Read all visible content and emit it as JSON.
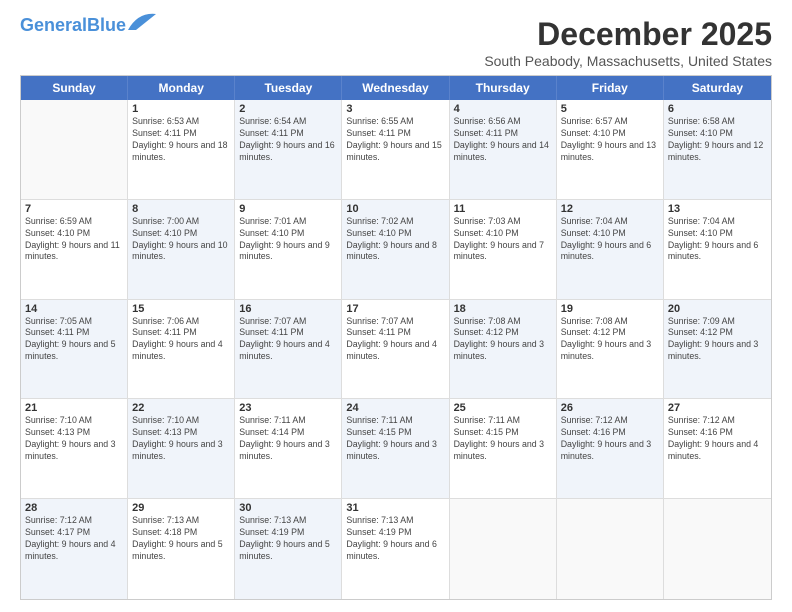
{
  "logo": {
    "part1": "General",
    "part2": "Blue"
  },
  "title": "December 2025",
  "subtitle": "South Peabody, Massachusetts, United States",
  "header_days": [
    "Sunday",
    "Monday",
    "Tuesday",
    "Wednesday",
    "Thursday",
    "Friday",
    "Saturday"
  ],
  "weeks": [
    [
      {
        "day": "",
        "sunrise": "",
        "sunset": "",
        "daylight": "",
        "shaded": false,
        "empty": true
      },
      {
        "day": "1",
        "sunrise": "Sunrise: 6:53 AM",
        "sunset": "Sunset: 4:11 PM",
        "daylight": "Daylight: 9 hours and 18 minutes.",
        "shaded": false,
        "empty": false
      },
      {
        "day": "2",
        "sunrise": "Sunrise: 6:54 AM",
        "sunset": "Sunset: 4:11 PM",
        "daylight": "Daylight: 9 hours and 16 minutes.",
        "shaded": true,
        "empty": false
      },
      {
        "day": "3",
        "sunrise": "Sunrise: 6:55 AM",
        "sunset": "Sunset: 4:11 PM",
        "daylight": "Daylight: 9 hours and 15 minutes.",
        "shaded": false,
        "empty": false
      },
      {
        "day": "4",
        "sunrise": "Sunrise: 6:56 AM",
        "sunset": "Sunset: 4:11 PM",
        "daylight": "Daylight: 9 hours and 14 minutes.",
        "shaded": true,
        "empty": false
      },
      {
        "day": "5",
        "sunrise": "Sunrise: 6:57 AM",
        "sunset": "Sunset: 4:10 PM",
        "daylight": "Daylight: 9 hours and 13 minutes.",
        "shaded": false,
        "empty": false
      },
      {
        "day": "6",
        "sunrise": "Sunrise: 6:58 AM",
        "sunset": "Sunset: 4:10 PM",
        "daylight": "Daylight: 9 hours and 12 minutes.",
        "shaded": true,
        "empty": false
      }
    ],
    [
      {
        "day": "7",
        "sunrise": "Sunrise: 6:59 AM",
        "sunset": "Sunset: 4:10 PM",
        "daylight": "Daylight: 9 hours and 11 minutes.",
        "shaded": false,
        "empty": false
      },
      {
        "day": "8",
        "sunrise": "Sunrise: 7:00 AM",
        "sunset": "Sunset: 4:10 PM",
        "daylight": "Daylight: 9 hours and 10 minutes.",
        "shaded": true,
        "empty": false
      },
      {
        "day": "9",
        "sunrise": "Sunrise: 7:01 AM",
        "sunset": "Sunset: 4:10 PM",
        "daylight": "Daylight: 9 hours and 9 minutes.",
        "shaded": false,
        "empty": false
      },
      {
        "day": "10",
        "sunrise": "Sunrise: 7:02 AM",
        "sunset": "Sunset: 4:10 PM",
        "daylight": "Daylight: 9 hours and 8 minutes.",
        "shaded": true,
        "empty": false
      },
      {
        "day": "11",
        "sunrise": "Sunrise: 7:03 AM",
        "sunset": "Sunset: 4:10 PM",
        "daylight": "Daylight: 9 hours and 7 minutes.",
        "shaded": false,
        "empty": false
      },
      {
        "day": "12",
        "sunrise": "Sunrise: 7:04 AM",
        "sunset": "Sunset: 4:10 PM",
        "daylight": "Daylight: 9 hours and 6 minutes.",
        "shaded": true,
        "empty": false
      },
      {
        "day": "13",
        "sunrise": "Sunrise: 7:04 AM",
        "sunset": "Sunset: 4:10 PM",
        "daylight": "Daylight: 9 hours and 6 minutes.",
        "shaded": false,
        "empty": false
      }
    ],
    [
      {
        "day": "14",
        "sunrise": "Sunrise: 7:05 AM",
        "sunset": "Sunset: 4:11 PM",
        "daylight": "Daylight: 9 hours and 5 minutes.",
        "shaded": true,
        "empty": false
      },
      {
        "day": "15",
        "sunrise": "Sunrise: 7:06 AM",
        "sunset": "Sunset: 4:11 PM",
        "daylight": "Daylight: 9 hours and 4 minutes.",
        "shaded": false,
        "empty": false
      },
      {
        "day": "16",
        "sunrise": "Sunrise: 7:07 AM",
        "sunset": "Sunset: 4:11 PM",
        "daylight": "Daylight: 9 hours and 4 minutes.",
        "shaded": true,
        "empty": false
      },
      {
        "day": "17",
        "sunrise": "Sunrise: 7:07 AM",
        "sunset": "Sunset: 4:11 PM",
        "daylight": "Daylight: 9 hours and 4 minutes.",
        "shaded": false,
        "empty": false
      },
      {
        "day": "18",
        "sunrise": "Sunrise: 7:08 AM",
        "sunset": "Sunset: 4:12 PM",
        "daylight": "Daylight: 9 hours and 3 minutes.",
        "shaded": true,
        "empty": false
      },
      {
        "day": "19",
        "sunrise": "Sunrise: 7:08 AM",
        "sunset": "Sunset: 4:12 PM",
        "daylight": "Daylight: 9 hours and 3 minutes.",
        "shaded": false,
        "empty": false
      },
      {
        "day": "20",
        "sunrise": "Sunrise: 7:09 AM",
        "sunset": "Sunset: 4:12 PM",
        "daylight": "Daylight: 9 hours and 3 minutes.",
        "shaded": true,
        "empty": false
      }
    ],
    [
      {
        "day": "21",
        "sunrise": "Sunrise: 7:10 AM",
        "sunset": "Sunset: 4:13 PM",
        "daylight": "Daylight: 9 hours and 3 minutes.",
        "shaded": false,
        "empty": false
      },
      {
        "day": "22",
        "sunrise": "Sunrise: 7:10 AM",
        "sunset": "Sunset: 4:13 PM",
        "daylight": "Daylight: 9 hours and 3 minutes.",
        "shaded": true,
        "empty": false
      },
      {
        "day": "23",
        "sunrise": "Sunrise: 7:11 AM",
        "sunset": "Sunset: 4:14 PM",
        "daylight": "Daylight: 9 hours and 3 minutes.",
        "shaded": false,
        "empty": false
      },
      {
        "day": "24",
        "sunrise": "Sunrise: 7:11 AM",
        "sunset": "Sunset: 4:15 PM",
        "daylight": "Daylight: 9 hours and 3 minutes.",
        "shaded": true,
        "empty": false
      },
      {
        "day": "25",
        "sunrise": "Sunrise: 7:11 AM",
        "sunset": "Sunset: 4:15 PM",
        "daylight": "Daylight: 9 hours and 3 minutes.",
        "shaded": false,
        "empty": false
      },
      {
        "day": "26",
        "sunrise": "Sunrise: 7:12 AM",
        "sunset": "Sunset: 4:16 PM",
        "daylight": "Daylight: 9 hours and 3 minutes.",
        "shaded": true,
        "empty": false
      },
      {
        "day": "27",
        "sunrise": "Sunrise: 7:12 AM",
        "sunset": "Sunset: 4:16 PM",
        "daylight": "Daylight: 9 hours and 4 minutes.",
        "shaded": false,
        "empty": false
      }
    ],
    [
      {
        "day": "28",
        "sunrise": "Sunrise: 7:12 AM",
        "sunset": "Sunset: 4:17 PM",
        "daylight": "Daylight: 9 hours and 4 minutes.",
        "shaded": true,
        "empty": false
      },
      {
        "day": "29",
        "sunrise": "Sunrise: 7:13 AM",
        "sunset": "Sunset: 4:18 PM",
        "daylight": "Daylight: 9 hours and 5 minutes.",
        "shaded": false,
        "empty": false
      },
      {
        "day": "30",
        "sunrise": "Sunrise: 7:13 AM",
        "sunset": "Sunset: 4:19 PM",
        "daylight": "Daylight: 9 hours and 5 minutes.",
        "shaded": true,
        "empty": false
      },
      {
        "day": "31",
        "sunrise": "Sunrise: 7:13 AM",
        "sunset": "Sunset: 4:19 PM",
        "daylight": "Daylight: 9 hours and 6 minutes.",
        "shaded": false,
        "empty": false
      },
      {
        "day": "",
        "sunrise": "",
        "sunset": "",
        "daylight": "",
        "shaded": false,
        "empty": true
      },
      {
        "day": "",
        "sunrise": "",
        "sunset": "",
        "daylight": "",
        "shaded": false,
        "empty": true
      },
      {
        "day": "",
        "sunrise": "",
        "sunset": "",
        "daylight": "",
        "shaded": false,
        "empty": true
      }
    ]
  ]
}
